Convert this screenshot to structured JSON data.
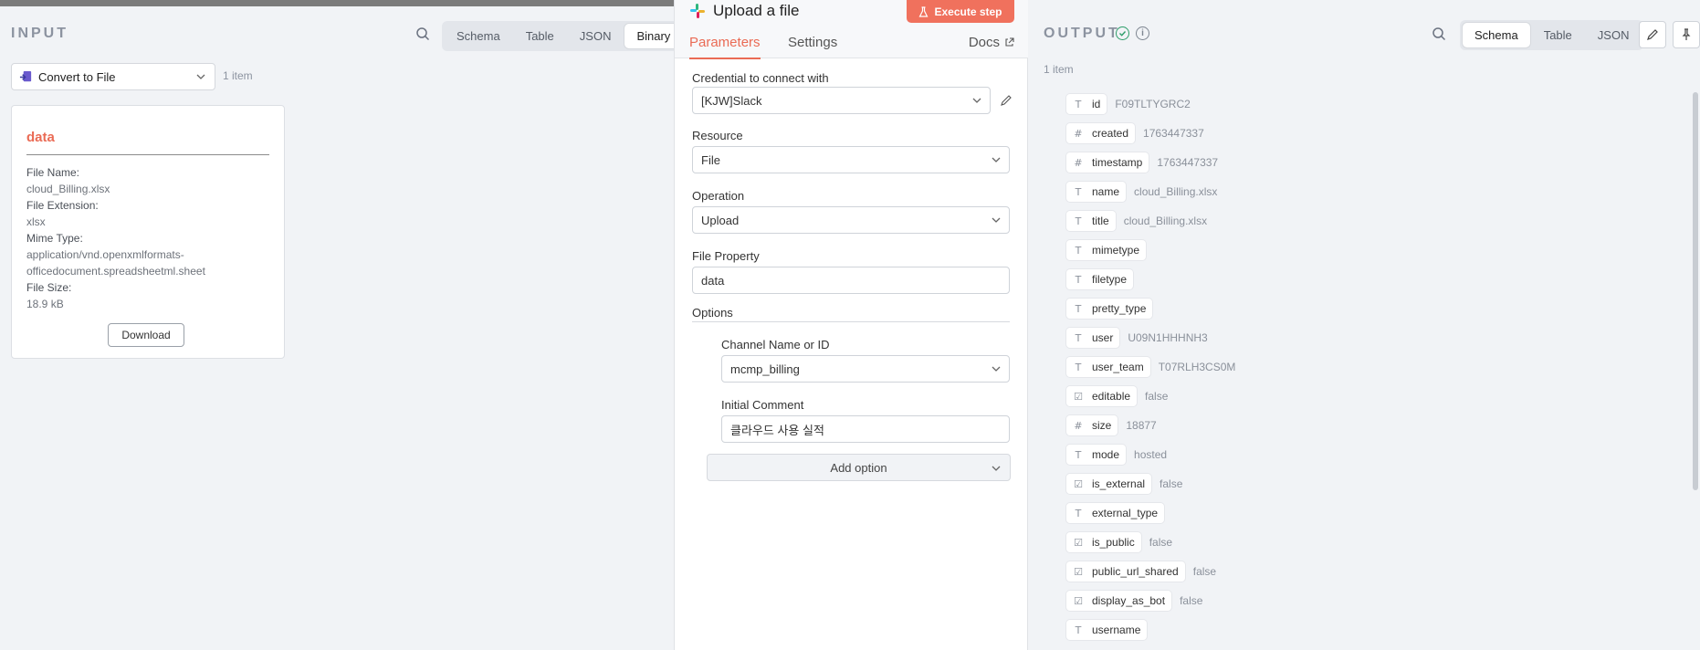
{
  "input": {
    "title": "INPUT",
    "view_tabs": [
      "Schema",
      "Table",
      "JSON",
      "Binary"
    ],
    "active_tab": "Binary",
    "node_selector": "Convert to File",
    "item_count": "1 item",
    "binary": {
      "title": "data",
      "file_name_label": "File Name:",
      "file_name": "cloud_Billing.xlsx",
      "file_extension_label": "File Extension:",
      "file_extension": "xlsx",
      "mime_type_label": "Mime Type:",
      "mime_type_line1": "application/vnd.openxmlformats-",
      "mime_type_line2": "officedocument.spreadsheetml.sheet",
      "file_size_label": "File Size:",
      "file_size": "18.9 kB",
      "download_label": "Download"
    }
  },
  "node": {
    "title": "Upload a file",
    "execute_label": "Execute step",
    "tabs": [
      "Parameters",
      "Settings"
    ],
    "docs_label": "Docs",
    "credential_label": "Credential to connect with",
    "credential_value": "[KJW]Slack",
    "resource_label": "Resource",
    "resource_value": "File",
    "operation_label": "Operation",
    "operation_value": "Upload",
    "file_property_label": "File Property",
    "file_property_value": "data",
    "options_label": "Options",
    "channel_label": "Channel Name or ID",
    "channel_value": "mcmp_billing",
    "comment_label": "Initial Comment",
    "comment_value": "클라우드 사용 실적",
    "add_option_label": "Add option"
  },
  "output": {
    "title": "OUTPUT",
    "view_tabs": [
      "Schema",
      "Table",
      "JSON"
    ],
    "active_tab": "Schema",
    "item_count": "1 item",
    "fields": [
      {
        "type": "T",
        "key": "id",
        "value": "F09TLTYGRC2"
      },
      {
        "type": "#",
        "key": "created",
        "value": "1763447337"
      },
      {
        "type": "#",
        "key": "timestamp",
        "value": "1763447337"
      },
      {
        "type": "T",
        "key": "name",
        "value": "cloud_Billing.xlsx"
      },
      {
        "type": "T",
        "key": "title",
        "value": "cloud_Billing.xlsx"
      },
      {
        "type": "T",
        "key": "mimetype",
        "value": ""
      },
      {
        "type": "T",
        "key": "filetype",
        "value": ""
      },
      {
        "type": "T",
        "key": "pretty_type",
        "value": ""
      },
      {
        "type": "T",
        "key": "user",
        "value": "U09N1HHHNH3"
      },
      {
        "type": "T",
        "key": "user_team",
        "value": "T07RLH3CS0M"
      },
      {
        "type": "☑",
        "key": "editable",
        "value": "false"
      },
      {
        "type": "#",
        "key": "size",
        "value": "18877"
      },
      {
        "type": "T",
        "key": "mode",
        "value": "hosted"
      },
      {
        "type": "☑",
        "key": "is_external",
        "value": "false"
      },
      {
        "type": "T",
        "key": "external_type",
        "value": ""
      },
      {
        "type": "☑",
        "key": "is_public",
        "value": "false"
      },
      {
        "type": "☑",
        "key": "public_url_shared",
        "value": "false"
      },
      {
        "type": "☑",
        "key": "display_as_bot",
        "value": "false"
      },
      {
        "type": "T",
        "key": "username",
        "value": ""
      }
    ]
  },
  "colors": {
    "accent": "#ea6b55",
    "execute": "#f0715d",
    "success": "#2e9e6a"
  }
}
